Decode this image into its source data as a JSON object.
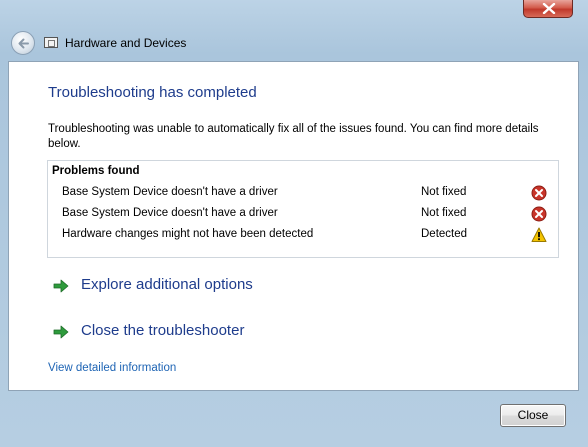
{
  "window": {
    "title": "Hardware and Devices"
  },
  "main": {
    "heading": "Troubleshooting has completed",
    "description": "Troubleshooting was unable to automatically fix all of the issues found. You can find more details below.",
    "problems": {
      "title": "Problems found",
      "rows": [
        {
          "name": "Base System Device doesn't have a driver",
          "status": "Not fixed",
          "icon": "error-icon"
        },
        {
          "name": "Base System Device doesn't have a driver",
          "status": "Not fixed",
          "icon": "error-icon"
        },
        {
          "name": "Hardware changes might not have been detected",
          "status": "Detected",
          "icon": "warning-icon"
        }
      ]
    },
    "options": [
      {
        "label": "Explore additional options",
        "icon": "green-arrow-icon"
      },
      {
        "label": "Close the troubleshooter",
        "icon": "green-arrow-icon"
      }
    ],
    "detail_link": "View detailed information"
  },
  "footer": {
    "close_label": "Close"
  },
  "colors": {
    "accent": "#1e3c8c",
    "link": "#1e64b4",
    "error": "#c0392b",
    "warning": "#f2c200",
    "arrow": "#2e9b3c"
  }
}
